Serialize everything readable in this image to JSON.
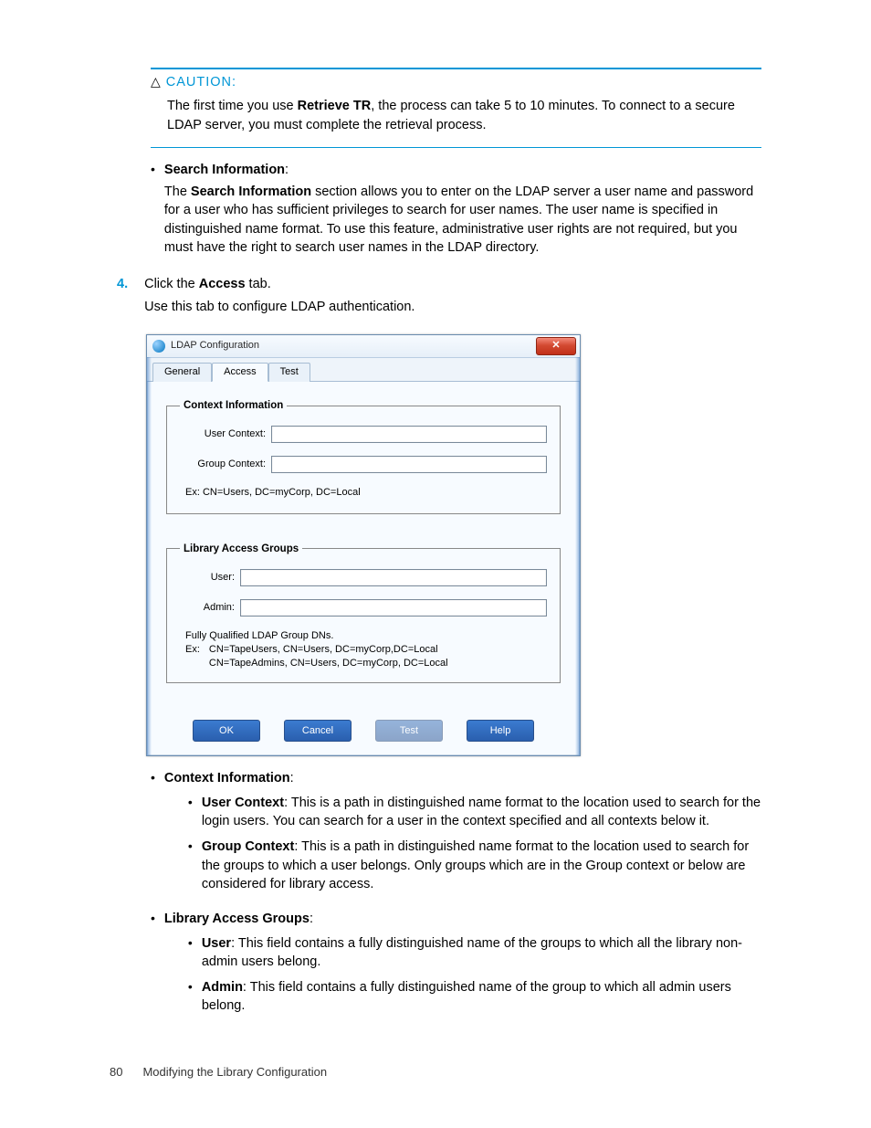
{
  "caution": {
    "label": "CAUTION:",
    "body_before": "The first time you use ",
    "bold": "Retrieve TR",
    "body_after": ", the process can take 5 to 10 minutes. To connect to a secure LDAP server, you must complete the retrieval process."
  },
  "search_info": {
    "heading": "Search Information",
    "text_before": "The ",
    "bold": "Search Information",
    "text_after": " section allows you to enter on the LDAP server a user name and password for a user who has sufficient privileges to search for user names. The user name is specified in distinguished name format. To use this feature, administrative user rights are not required, but you must have the right to search user names in the LDAP directory."
  },
  "step4": {
    "num": "4.",
    "line1_before": "Click the ",
    "bold": "Access",
    "line1_after": " tab.",
    "line2": "Use this tab to configure LDAP authentication."
  },
  "dialog": {
    "title": "LDAP Configuration",
    "tabs": {
      "general": "General",
      "access": "Access",
      "test": "Test"
    },
    "context": {
      "legend": "Context Information",
      "user_label": "User Context:",
      "group_label": "Group Context:",
      "hint": "Ex: CN=Users, DC=myCorp, DC=Local"
    },
    "libgroups": {
      "legend": "Library Access Groups",
      "user_label": "User:",
      "admin_label": "Admin:",
      "hint1": "Fully Qualified LDAP Group DNs.",
      "hint2_lead": "Ex:",
      "hint2a": "CN=TapeUsers, CN=Users, DC=myCorp,DC=Local",
      "hint2b": "CN=TapeAdmins, CN=Users, DC=myCorp, DC=Local"
    },
    "buttons": {
      "ok": "OK",
      "cancel": "Cancel",
      "test": "Test",
      "help": "Help"
    }
  },
  "context_info": {
    "heading": "Context Information",
    "user": {
      "bold": "User Context",
      "text": ": This is a path in distinguished name format to the location used to search for the login users. You can search for a user in the context specified and all contexts below it."
    },
    "group": {
      "bold": "Group Context",
      "text": ": This is a path in distinguished name format to the location used to search for the groups to which a user belongs. Only groups which are in the Group context or below are considered for library access."
    }
  },
  "libgroups_info": {
    "heading": "Library Access Groups",
    "user": {
      "bold": "User",
      "text": ": This field contains a fully distinguished name of the groups to which all the library non-admin users belong."
    },
    "admin": {
      "bold": "Admin",
      "text": ": This field contains a fully distinguished name of the group to which all admin users belong."
    }
  },
  "footer": {
    "page": "80",
    "title": "Modifying the Library Configuration"
  }
}
